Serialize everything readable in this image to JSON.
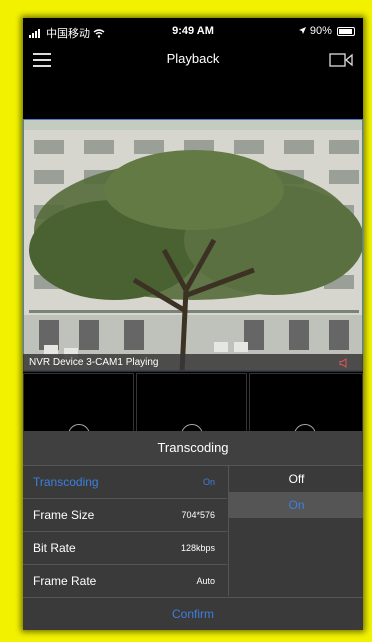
{
  "status_bar": {
    "carrier": "中国移动",
    "time": "9:49 AM",
    "battery": "90%",
    "battery_level": 0.9
  },
  "nav": {
    "title": "Playback"
  },
  "video": {
    "camera_label": "NVR Device 3-CAM1 Playing"
  },
  "panel": {
    "title": "Transcoding",
    "rows": [
      {
        "label": "Transcoding",
        "value": "On"
      },
      {
        "label": "Frame Size",
        "value": "704*576"
      },
      {
        "label": "Bit Rate",
        "value": "128kbps"
      },
      {
        "label": "Frame Rate",
        "value": "Auto"
      }
    ],
    "options": [
      "Off",
      "On"
    ],
    "confirm": "Confirm"
  },
  "colors": {
    "accent": "#3d7fe0",
    "frame": "#f2f200"
  }
}
